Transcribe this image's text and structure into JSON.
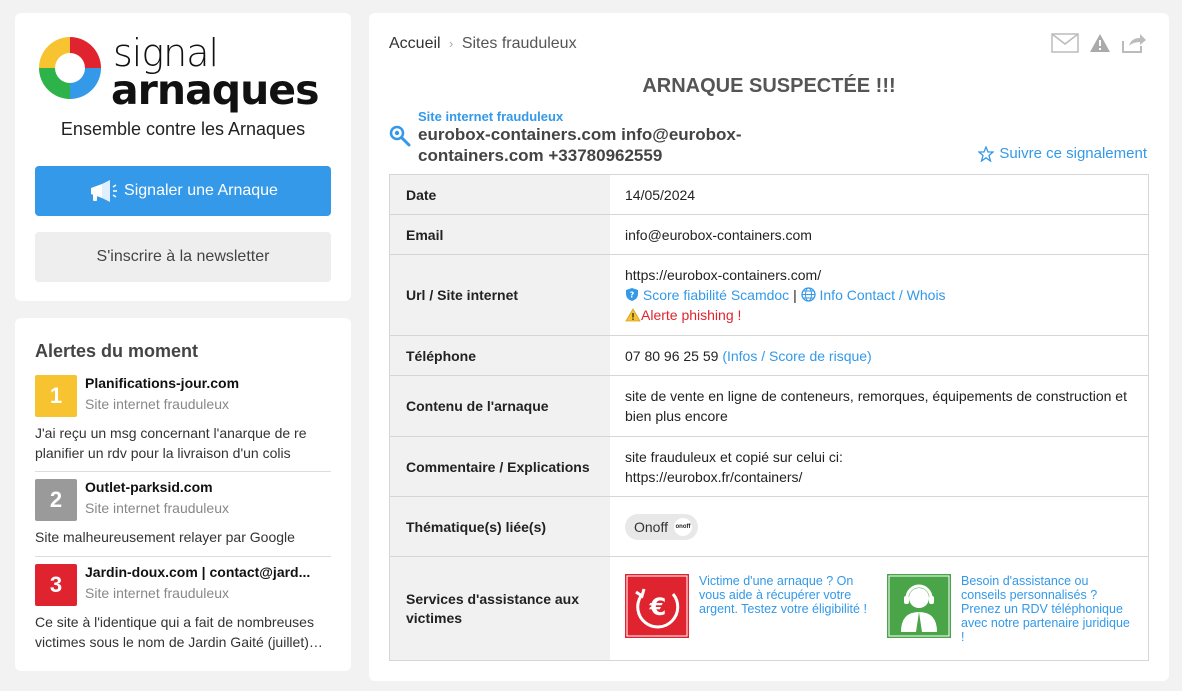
{
  "sidebar": {
    "logo_line1": "signal",
    "logo_line2": "arnaques",
    "tagline": "Ensemble contre les Arnaques",
    "report_button": "Signaler une Arnaque",
    "newsletter_button": "S'inscrire à la newsletter"
  },
  "alerts": {
    "title": "Alertes du moment",
    "items": [
      {
        "rank": "1",
        "color": "#f7c331",
        "name": "Planifications-jour.com",
        "type": "Site internet frauduleux",
        "desc": "J'ai reçu un msg concernant l'anarque de re planifier un rdv pour la livraison d'un colis"
      },
      {
        "rank": "2",
        "color": "#9a9a9a",
        "name": "Outlet-parksid.com",
        "type": "Site internet frauduleux",
        "desc": "Site malheureusement relayer par Google"
      },
      {
        "rank": "3",
        "color": "#e0242f",
        "name": "Jardin-doux.com | contact@jard...",
        "type": "Site internet frauduleux",
        "desc": "Ce site à l'identique qui a fait de nombreuses victimes sous le nom de Jardin Gaité (juillet)…"
      }
    ]
  },
  "breadcrumb": {
    "home": "Accueil",
    "separator": "›",
    "current": "Sites frauduleux"
  },
  "report": {
    "title": "ARNAQUE SUSPECTÉE !!!",
    "type": "Site internet frauduleux",
    "subject": "eurobox-containers.com info@eurobox-containers.com +33780962559",
    "follow": "Suivre ce signalement"
  },
  "table": {
    "date_label": "Date",
    "date_value": "14/05/2024",
    "email_label": "Email",
    "email_value": "info@eurobox-containers.com",
    "url_label": "Url / Site internet",
    "url_value": "https://eurobox-containers.com/",
    "url_score": "Score fiabilité Scamdoc",
    "url_sep": "|",
    "url_whois": "Info Contact / Whois",
    "url_alert": "Alerte phishing !",
    "phone_label": "Téléphone",
    "phone_value": "07 80 96 25 59",
    "phone_link": "(Infos / Score de risque)",
    "content_label": "Contenu de l'arnaque",
    "content_value": "site de vente en ligne de conteneurs, remorques, équipements de construction et bien plus encore",
    "comment_label": "Commentaire / Explications",
    "comment_line1": "site frauduleux et copié sur celui ci:",
    "comment_line2": "https://eurobox.fr/containers/",
    "theme_label": "Thématique(s) liée(s)",
    "theme_tag": "Onoff",
    "theme_logo_text": "onoff",
    "services_label": "Services d'assistance aux victimes",
    "service1": "Victime d'une arnaque ? On vous aide à récupérer votre argent. Testez votre éligibilité !",
    "service2": "Besoin d'assistance ou conseils personnalisés ? Prenez un RDV téléphonique avec notre partenaire juridique !"
  }
}
